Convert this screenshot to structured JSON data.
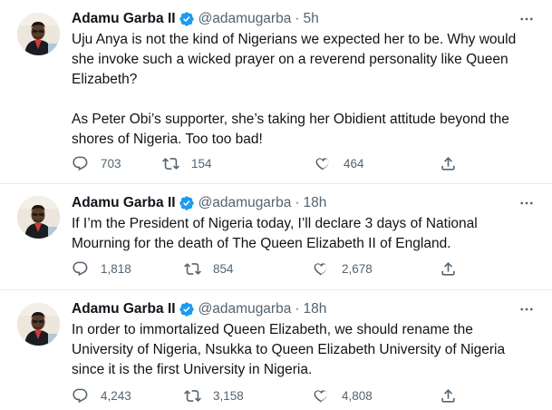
{
  "colors": {
    "text": "#0f1419",
    "secondary": "#536471",
    "verified": "#1d9bf0",
    "divider": "#e7e9ea"
  },
  "tweets": [
    {
      "name": "Adamu Garba II",
      "handle": "@adamugarba",
      "separator": "·",
      "time": "5h",
      "paragraphs": [
        "Uju Anya is not the kind of Nigerians we expected her to be. Why would she invoke such a wicked prayer on a reverend personality like Queen Elizabeth?",
        "As Peter Obi’s supporter, she’s taking her Obidient attitude beyond the shores of Nigeria. Too too bad!"
      ],
      "replies": "703",
      "retweets": "154",
      "likes": "464"
    },
    {
      "name": "Adamu Garba II",
      "handle": "@adamugarba",
      "separator": "·",
      "time": "18h",
      "paragraphs": [
        "If I’m the President of Nigeria today, I’ll declare 3 days of National Mourning for the death of The Queen Elizabeth II of England."
      ],
      "replies": "1,818",
      "retweets": "854",
      "likes": "2,678"
    },
    {
      "name": "Adamu Garba II",
      "handle": "@adamugarba",
      "separator": "·",
      "time": "18h",
      "paragraphs": [
        "In order to immortalized Queen Elizabeth, we should rename the University of Nigeria, Nsukka to Queen Elizabeth University of Nigeria since it is the first University in Nigeria."
      ],
      "replies": "4,243",
      "retweets": "3,158",
      "likes": "4,808"
    }
  ],
  "icons": {
    "avatar": "profile-photo",
    "verified": "verified-badge-icon",
    "more": "more-icon",
    "reply": "reply-icon",
    "retweet": "retweet-icon",
    "like": "heart-icon",
    "share": "share-icon"
  }
}
